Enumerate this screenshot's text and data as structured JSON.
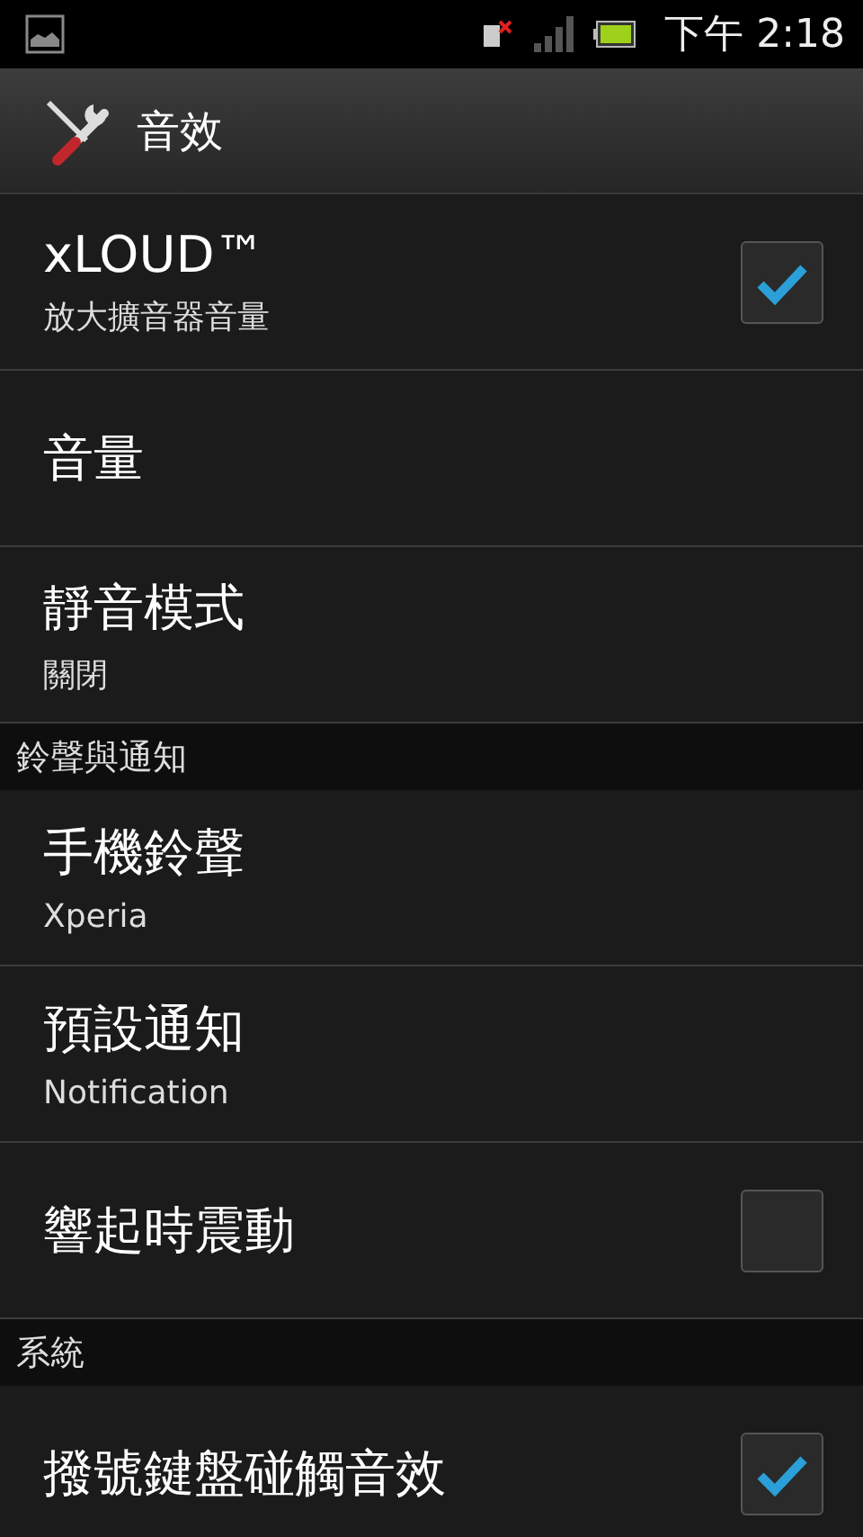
{
  "status_bar": {
    "time": "下午 2:18"
  },
  "action_bar": {
    "title": "音效"
  },
  "items": [
    {
      "kind": "pref",
      "title": "xLOUD™",
      "summary": "放大擴音器音量",
      "checked": true
    },
    {
      "kind": "pref",
      "title": "音量"
    },
    {
      "kind": "pref",
      "title": "靜音模式",
      "summary": "關閉"
    },
    {
      "kind": "header",
      "title": "鈴聲與通知"
    },
    {
      "kind": "pref",
      "title": "手機鈴聲",
      "summary": "Xperia"
    },
    {
      "kind": "pref",
      "title": "預設通知",
      "summary": "Notification"
    },
    {
      "kind": "pref",
      "title": "響起時震動",
      "checked": false
    },
    {
      "kind": "header",
      "title": "系統"
    },
    {
      "kind": "pref",
      "title": "撥號鍵盤碰觸音效",
      "checked": true
    }
  ]
}
